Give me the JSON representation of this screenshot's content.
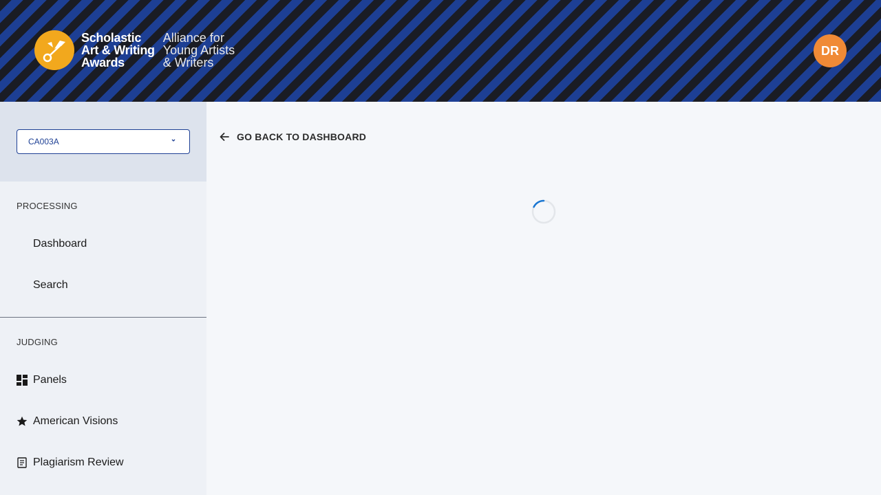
{
  "header": {
    "logo_line1": "Scholastic",
    "logo_line2": "Art & Writing",
    "logo_line3": "Awards",
    "tag_line1": "Alliance for",
    "tag_line2": "Young Artists",
    "tag_line3": "& Writers",
    "avatar_initials": "DR"
  },
  "sidebar": {
    "org_select_value": "CA003A",
    "sections": [
      {
        "label": "PROCESSING",
        "items": [
          {
            "label": "Dashboard",
            "icon": ""
          },
          {
            "label": "Search",
            "icon": ""
          }
        ]
      },
      {
        "label": "JUDGING",
        "items": [
          {
            "label": "Panels",
            "icon": "dashboard-grid-icon"
          },
          {
            "label": "American Visions",
            "icon": "star-icon"
          },
          {
            "label": "Plagiarism Review",
            "icon": "document-icon"
          }
        ]
      }
    ]
  },
  "main": {
    "back_label": "GO BACK TO DASHBOARD",
    "loading": true
  },
  "colors": {
    "header_stripe_dark": "#1a1c24",
    "header_stripe_blue": "#1d3f94",
    "logo_gold": "#f2a81d",
    "avatar_orange": "#f08a36",
    "spinner_blue": "#1976d2"
  }
}
